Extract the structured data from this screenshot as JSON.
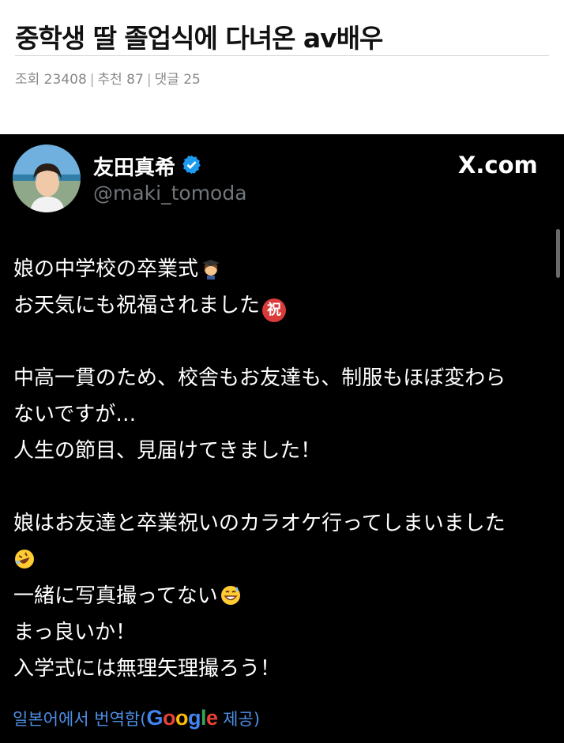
{
  "post": {
    "title": "중학생 딸 졸업식에 다녀온 av배우",
    "views_label": "조회 23408",
    "recommend_label": "추천 87",
    "comments_label": "댓글 25",
    "separator": "|"
  },
  "tweet": {
    "name": "友田真希",
    "handle": "@maki_tomoda",
    "site": "X.com",
    "lines": [
      "娘の中学校の卒業式",
      "お天気にも祝福されました",
      "",
      "中高一貫のため、校舎もお友達も、制服もほぼ変わら",
      "ないですが…",
      "人生の節目、見届けてきました！",
      "",
      "娘はお友達と卒業祝いのカラオケ行ってしまいました",
      "",
      "一緒に写真撮ってない",
      "まっ良いか！",
      "入学式には無理矢理撮ろう！"
    ],
    "emoji_celebrate": "祝",
    "translation": {
      "prefix": "일본어에서 번역함(",
      "google": [
        "G",
        "o",
        "o",
        "g",
        "l",
        "e"
      ],
      "suffix": " 제공)"
    }
  },
  "colors": {
    "tweet_bg": "#000000",
    "link_blue": "#4e8fe6",
    "verified_blue": "#1d9bf0"
  }
}
